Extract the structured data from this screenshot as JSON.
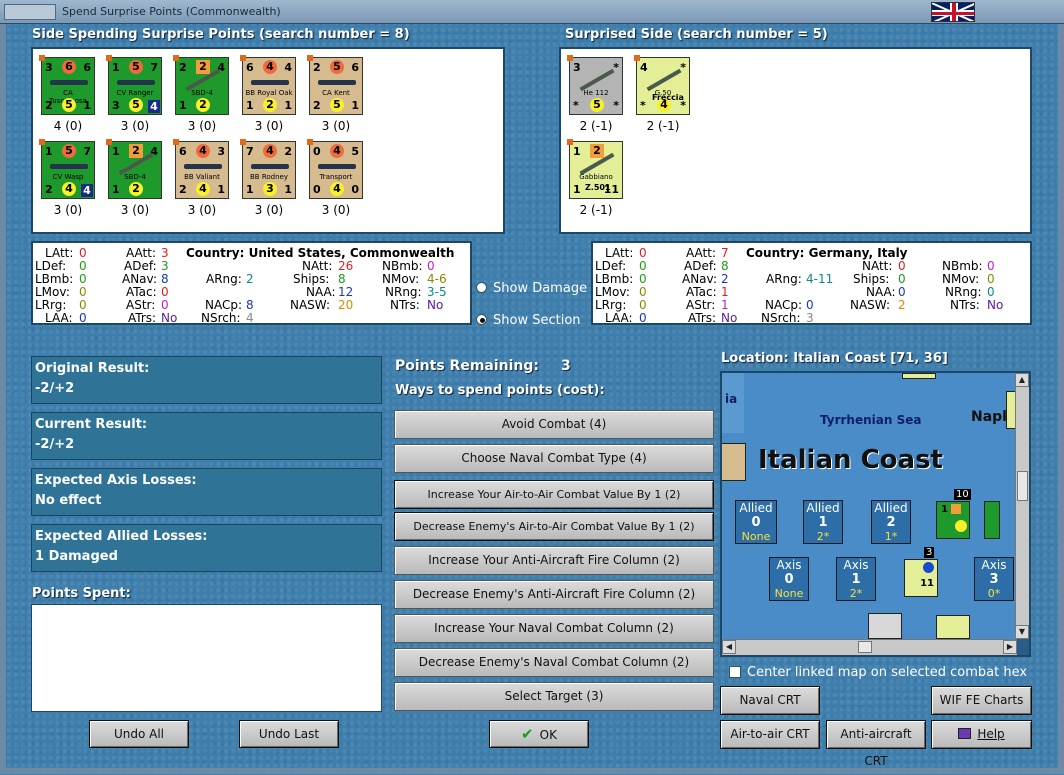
{
  "window": {
    "title": "Spend Surprise Points (Commonwealth)"
  },
  "left_header": "Side Spending Surprise Points (search number = 8)",
  "right_header": "Surprised Side (search number = 5)",
  "left_units": [
    {
      "name": "CA Tuscaloosa",
      "tl": "3",
      "tc": "6",
      "tr": "6",
      "bl": "2",
      "bc": "5",
      "br": "1",
      "value": "4 (0)"
    },
    {
      "name": "CV Ranger",
      "tl": "1",
      "tc": "5",
      "tr": "7",
      "bl": "3",
      "bc": "5",
      "br": "4",
      "value": "3 (0)"
    },
    {
      "name": "SBD-4",
      "tl": "2",
      "tc": "2",
      "tr": "4",
      "bl": "1",
      "bc": "2",
      "br": "",
      "value": "3 (0)"
    },
    {
      "name": "BB Royal Oak",
      "tl": "6",
      "tc": "4",
      "tr": "4",
      "bl": "1",
      "bc": "2",
      "br": "1",
      "value": "3 (0)"
    },
    {
      "name": "CA Kent",
      "tl": "2",
      "tc": "5",
      "tr": "6",
      "bl": "2",
      "bc": "5",
      "br": "1",
      "value": "3 (0)"
    },
    {
      "name": "CV Wasp",
      "tl": "1",
      "tc": "5",
      "tr": "7",
      "bl": "2",
      "bc": "4",
      "br": "4",
      "value": "3 (0)"
    },
    {
      "name": "SBD-4",
      "tl": "1",
      "tc": "2",
      "tr": "4",
      "bl": "1",
      "bc": "2",
      "br": "",
      "value": "3 (0)"
    },
    {
      "name": "BB Valiant",
      "tl": "6",
      "tc": "4",
      "tr": "3",
      "bl": "2",
      "bc": "4",
      "br": "1",
      "value": "3 (0)"
    },
    {
      "name": "BB Rodney",
      "tl": "7",
      "tc": "4",
      "tr": "2",
      "bl": "1",
      "bc": "3",
      "br": "1",
      "value": "3 (0)"
    },
    {
      "name": "Transport",
      "tl": "0",
      "tc": "4",
      "tr": "5",
      "bl": "0",
      "bc": "4",
      "br": "0",
      "value": "3 (0)"
    }
  ],
  "right_units": [
    {
      "name": "He 112",
      "tl": "3",
      "tc": "",
      "tr": "*",
      "bl": "*",
      "bc": "5",
      "br": "*",
      "value": "2 (-1)"
    },
    {
      "name": "G.50",
      "tl": "4",
      "tc": "",
      "tr": "*",
      "bl": "*",
      "bc": "4",
      "br": "*",
      "value": "2 (-1)"
    },
    {
      "name": "Gabbiano",
      "tl": "1",
      "tc": "2",
      "tr": "",
      "bl": "1",
      "bc": "",
      "br": "11",
      "value": "2 (-1)"
    }
  ],
  "right_unit_labels": [
    "",
    "Freccia",
    "Z.501"
  ],
  "left_stats": {
    "country": "Country: United States, Commonwealth",
    "LAtt": "0",
    "LDef": "0",
    "LBmb": "0",
    "LMov": "0",
    "LRrg": "0",
    "LAA": "0",
    "AAtt": "3",
    "ADef": "3",
    "ANav": "8",
    "ATac": "0",
    "AStr": "0",
    "ATrs": "No",
    "ARng": "2",
    "NACp": "8",
    "NSrch": "4",
    "NAtt": "26",
    "Ships": "8",
    "NAA": "12",
    "NASW": "20",
    "NBmb": "0",
    "NMov": "4-6",
    "NRng": "3-5",
    "NTrs": "No"
  },
  "right_stats": {
    "country": "Country: Germany, Italy",
    "LAtt": "0",
    "LDef": "0",
    "LBmb": "0",
    "LMov": "0",
    "LRrg": "0",
    "LAA": "0",
    "AAtt": "7",
    "ADef": "8",
    "ANav": "2",
    "ATac": "1",
    "AStr": "1",
    "ATrs": "No",
    "ARng": "4-11",
    "NACp": "0",
    "NSrch": "3",
    "NAtt": "0",
    "Ships": "0",
    "NAA": "0",
    "NASW": "2",
    "NBmb": "0",
    "NMov": "0",
    "NRng": "0",
    "NTrs": "No"
  },
  "radios": {
    "damage": "Show Damage",
    "section": "Show Section"
  },
  "results": {
    "original_title": "Original Result:",
    "original_value": "-2/+2",
    "current_title": "Current Result:",
    "current_value": "-2/+2",
    "axis_title": "Expected Axis Losses:",
    "axis_value": "No effect",
    "allied_title": "Expected Allied Losses:",
    "allied_value": "1 Damaged",
    "spent_title": "Points Spent:"
  },
  "points_remaining_label": "Points Remaining:",
  "points_remaining_value": "3",
  "ways_label": "Ways to spend points (cost):",
  "spend_options": [
    "Avoid Combat (4)",
    "Choose Naval Combat Type (4)",
    "Increase Your Air-to-Air Combat Value By 1 (2)",
    "Decrease Enemy's Air-to-Air Combat Value By 1 (2)",
    "Increase Your Anti-Aircraft Fire Column (2)",
    "Decrease Enemy's Anti-Aircraft Fire Column (2)",
    "Increase Your Naval Combat Column (2)",
    "Decrease Enemy's Naval Combat Column (2)",
    "Select Target (3)"
  ],
  "location": "Location: Italian Coast [71, 36]",
  "map": {
    "sea_name": "Tyrrhenian Sea",
    "coast_name": "Italian Coast",
    "left_fragment": "ia",
    "right_fragment": "Napl",
    "stack_count_1": "10",
    "stack_count_2": "3",
    "allied_boxes": [
      {
        "label": "Allied",
        "num": "0",
        "sub": "None"
      },
      {
        "label": "Allied",
        "num": "1",
        "sub": "2*"
      },
      {
        "label": "Allied",
        "num": "2",
        "sub": "1*"
      }
    ],
    "axis_boxes": [
      {
        "label": "Axis",
        "num": "0",
        "sub": "None"
      },
      {
        "label": "Axis",
        "num": "1",
        "sub": "2*"
      },
      {
        "label": "Axis",
        "num": "3",
        "sub": "0*"
      }
    ]
  },
  "center_linked": "Center linked map on selected combat hex",
  "buttons": {
    "undo_all": "Undo All",
    "undo_last": "Undo Last",
    "ok": "OK",
    "naval_crt": "Naval CRT",
    "wif_fe": "WIF FE Charts",
    "air_crt": "Air-to-air CRT",
    "aa_crt": "Anti-aircraft CRT",
    "help": "Help"
  },
  "colors": {
    "accent": "#3f7fae",
    "green": "#1e9a2c",
    "tan": "#d6bb8e",
    "yellow": "#e3ee96"
  }
}
